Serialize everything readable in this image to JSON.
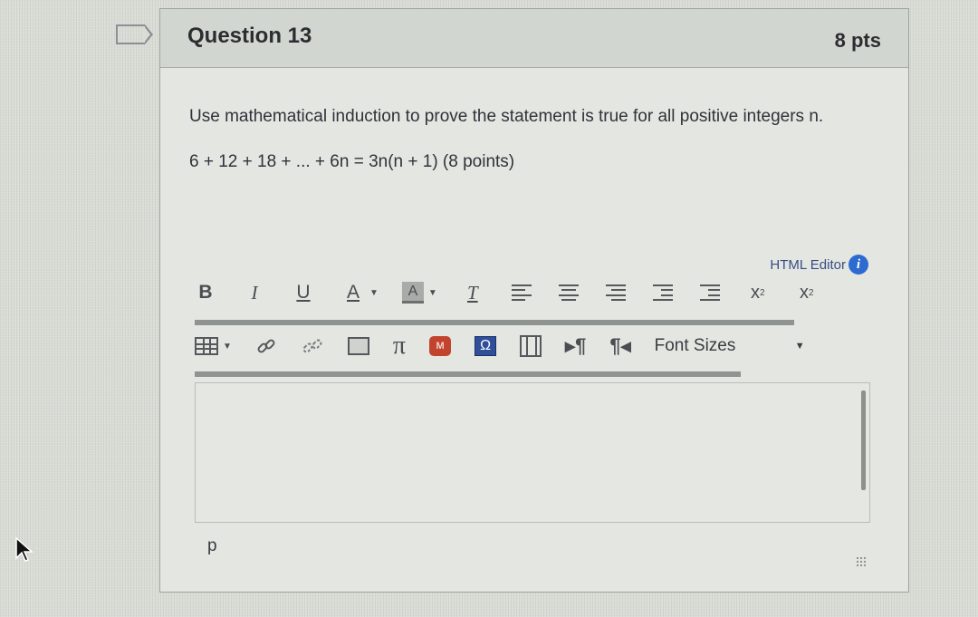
{
  "question": {
    "title": "Question 13",
    "points": "8 pts",
    "prompt": "Use mathematical induction to prove the statement is true for all positive integers n.",
    "statement": "6 + 12 + 18 + ... + 6n = 3n(n + 1) (8 points)"
  },
  "editor": {
    "html_editor_label": "HTML Editor",
    "toolbar1": {
      "bold": "B",
      "italic": "I",
      "underline": "U",
      "font_color": "A",
      "background_color": "A",
      "clear_formatting": "T",
      "superscript": "x",
      "subscript": "x"
    },
    "toolbar2": {
      "font_sizes": "Font Sizes"
    },
    "path_label": "p"
  },
  "icons": {
    "flag": "bookmark-flag-icon",
    "info": "info-icon",
    "table": "table-icon",
    "link": "link-icon",
    "unlink": "unlink-icon",
    "image": "image-icon",
    "equation": "pi-equation-icon",
    "media": "media-icon",
    "special_char": "omega-icon",
    "embed": "film-icon",
    "ltr": "ltr-pilcrow-icon",
    "rtl": "rtl-pilcrow-icon",
    "cursor": "mouse-cursor-icon"
  },
  "colors": {
    "background": "#d9ddd6",
    "info_icon": "#2e6bd0",
    "media_icon": "#c2432e",
    "omega_icon": "#2f4f9a"
  }
}
